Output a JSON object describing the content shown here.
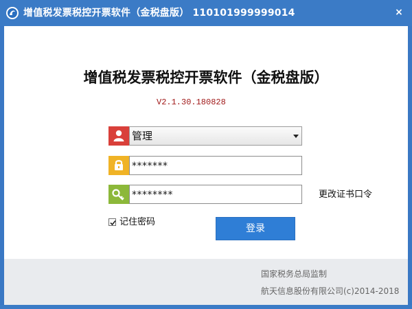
{
  "window": {
    "title": "增值税发票税控开票软件（金税盘版） 110101999999014",
    "close_label": "×"
  },
  "main": {
    "heading": "增值税发票税控开票软件（金税盘版）",
    "version": "V2.1.30.180828"
  },
  "form": {
    "user": {
      "value": "管理",
      "icon": "user-icon",
      "icon_color": "#d9403a"
    },
    "password": {
      "value": "*******",
      "icon": "lock-icon",
      "icon_color": "#f0b326"
    },
    "cert_password": {
      "value": "********",
      "icon": "key-icon",
      "icon_color": "#8cb83a"
    },
    "change_cert_label": "更改证书口令",
    "remember_label": "记住密码",
    "remember_checked": true,
    "login_label": "登录"
  },
  "footer": {
    "line1": "国家税务总局监制",
    "line2": "航天信息股份有限公司(c)2014-2018"
  },
  "colors": {
    "titlebar": "#3b7bc6",
    "login_button": "#2f7ed6",
    "version_text": "#a01818"
  }
}
